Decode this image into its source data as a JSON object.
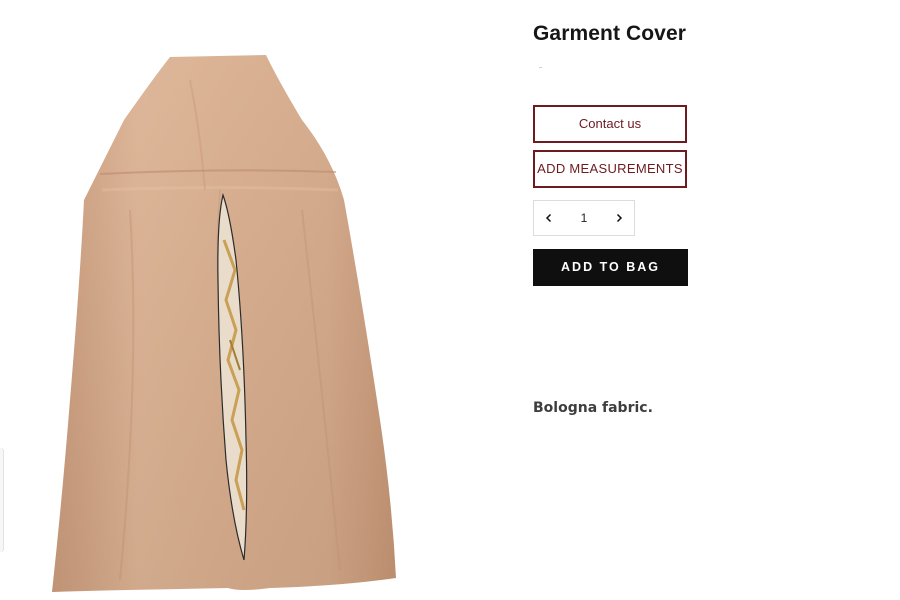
{
  "product": {
    "title": "Garment Cover",
    "image_alt": "Garment Cover",
    "description": "Bologna fabric."
  },
  "actions": {
    "contact_label": "Contact us",
    "measurements_label": "ADD MEASUREMENTS",
    "add_to_bag_label": "ADD TO BAG"
  },
  "quantity": {
    "value": "1",
    "decrease_icon": "chevron-left-icon",
    "increase_icon": "chevron-right-icon"
  },
  "colors": {
    "accent": "#6e1b1f",
    "button_dark": "#0f0f0f",
    "fabric": "#d6ab8c"
  }
}
